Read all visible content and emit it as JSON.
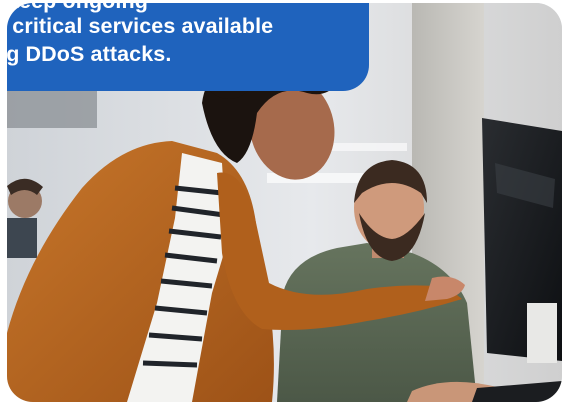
{
  "caption": {
    "lines": [
      "keep ongoing",
      "o critical services available",
      "ng DDoS attacks."
    ]
  },
  "photo": {
    "subject": "photo-two-coworkers-at-monitor"
  },
  "colors": {
    "caption_bg": "#1f63bd",
    "caption_text": "#ffffff",
    "mustard_jacket": "#b8661f",
    "green_shirt": "#5b6a55"
  }
}
